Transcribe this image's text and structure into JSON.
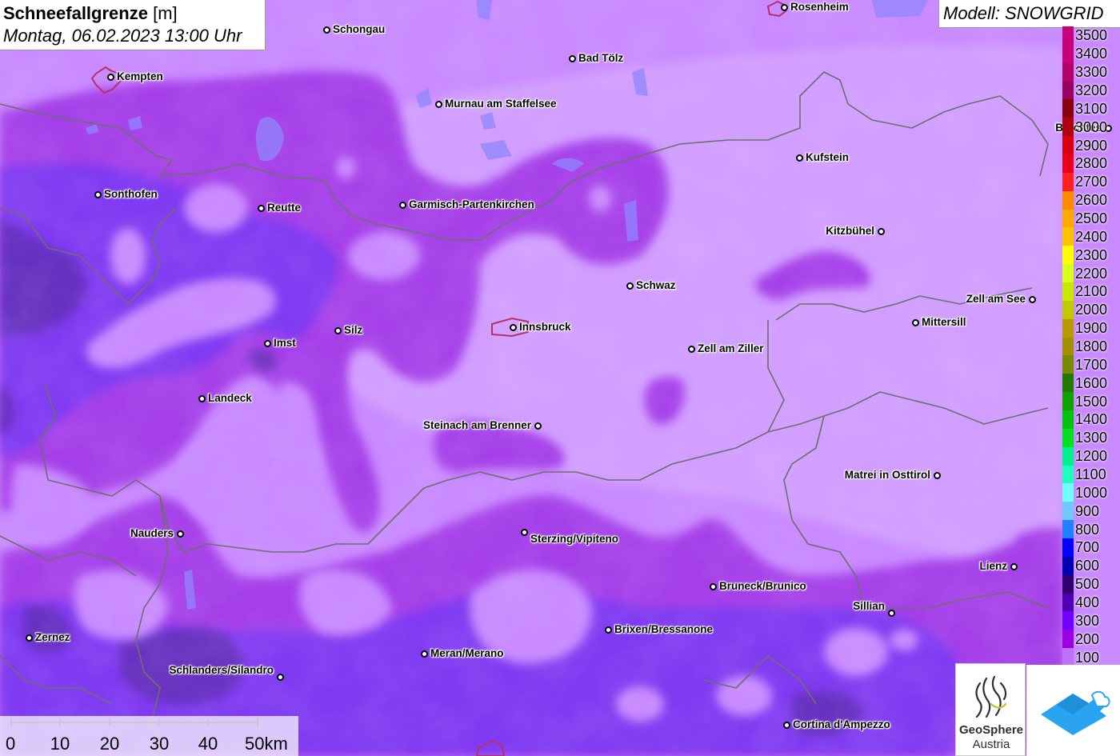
{
  "title": {
    "main": "Schneefallgrenze",
    "unit": "[m]",
    "date": "Montag, 06.02.2023 13:00 Uhr"
  },
  "model": "Modell: SNOWGRID",
  "colors": {
    "base": "#c97fff",
    "band_100": "#b86cf0",
    "band_200": "#9b28e0",
    "band_300": "#7a1cf0",
    "band_400": "#5a22b0",
    "border_line": "#6f6f6f",
    "lake": "#8e88ff"
  },
  "legend": [
    {
      "label": "3500",
      "color": "#c8007a"
    },
    {
      "label": "3400",
      "color": "#c8007a"
    },
    {
      "label": "3300",
      "color": "#b4006a"
    },
    {
      "label": "3200",
      "color": "#9a0060"
    },
    {
      "label": "3100",
      "color": "#8a0010"
    },
    {
      "label": "3000",
      "color": "#b00010"
    },
    {
      "label": "2900",
      "color": "#d80010"
    },
    {
      "label": "2800",
      "color": "#e80018"
    },
    {
      "label": "2700",
      "color": "#ff2020"
    },
    {
      "label": "2600",
      "color": "#ff8a00"
    },
    {
      "label": "2500",
      "color": "#ffa800"
    },
    {
      "label": "2400",
      "color": "#ffc000"
    },
    {
      "label": "2300",
      "color": "#ffff00"
    },
    {
      "label": "2200",
      "color": "#d8ff20"
    },
    {
      "label": "2100",
      "color": "#c8e800"
    },
    {
      "label": "2000",
      "color": "#c0c800"
    },
    {
      "label": "1900",
      "color": "#b89a00"
    },
    {
      "label": "1800",
      "color": "#a09000"
    },
    {
      "label": "1700",
      "color": "#7a8a00"
    },
    {
      "label": "1600",
      "color": "#207a00"
    },
    {
      "label": "1500",
      "color": "#10a000"
    },
    {
      "label": "1400",
      "color": "#00c010"
    },
    {
      "label": "1300",
      "color": "#00e020"
    },
    {
      "label": "1200",
      "color": "#00f090"
    },
    {
      "label": "1100",
      "color": "#20ffc0"
    },
    {
      "label": "1000",
      "color": "#70ffff"
    },
    {
      "label": "900",
      "color": "#70c8ff"
    },
    {
      "label": "800",
      "color": "#2080ff"
    },
    {
      "label": "700",
      "color": "#0000ff"
    },
    {
      "label": "600",
      "color": "#0000b0"
    },
    {
      "label": "500",
      "color": "#300070"
    },
    {
      "label": "400",
      "color": "#5000b0"
    },
    {
      "label": "300",
      "color": "#7000ff"
    },
    {
      "label": "200",
      "color": "#9a00e0"
    },
    {
      "label": "100",
      "color": "#c070ff"
    }
  ],
  "cities": [
    {
      "id": "rosenheim",
      "label": "Rosenheim"
    },
    {
      "id": "schongau",
      "label": "Schongau"
    },
    {
      "id": "bad-toelz",
      "label": "Bad Tölz"
    },
    {
      "id": "kempten",
      "label": "Kempten"
    },
    {
      "id": "murnau",
      "label": "Murnau am Staffelsee"
    },
    {
      "id": "berchtesgaden",
      "label": "Berchtes"
    },
    {
      "id": "kufstein",
      "label": "Kufstein"
    },
    {
      "id": "sonthofen",
      "label": "Sonthofen"
    },
    {
      "id": "reutte",
      "label": "Reutte"
    },
    {
      "id": "garmisch",
      "label": "Garmisch-Partenkirchen"
    },
    {
      "id": "kitzbuehel",
      "label": "Kitzbühel"
    },
    {
      "id": "schwaz",
      "label": "Schwaz"
    },
    {
      "id": "zell-am-see",
      "label": "Zell am See"
    },
    {
      "id": "mittersill",
      "label": "Mittersill"
    },
    {
      "id": "innsbruck",
      "label": "Innsbruck"
    },
    {
      "id": "imst",
      "label": "Imst"
    },
    {
      "id": "silz",
      "label": "Silz"
    },
    {
      "id": "zell-am-ziller",
      "label": "Zell am Ziller"
    },
    {
      "id": "landeck",
      "label": "Landeck"
    },
    {
      "id": "steinach",
      "label": "Steinach am Brenner"
    },
    {
      "id": "matrei",
      "label": "Matrei in Osttirol"
    },
    {
      "id": "nauders",
      "label": "Nauders"
    },
    {
      "id": "sterzing",
      "label": "Sterzing/Vipiteno"
    },
    {
      "id": "lienz",
      "label": "Lienz"
    },
    {
      "id": "bruneck",
      "label": "Bruneck/Brunico"
    },
    {
      "id": "sillian",
      "label": "Sillian"
    },
    {
      "id": "brixen",
      "label": "Brixen/Bressanone"
    },
    {
      "id": "zernez",
      "label": "Zernez"
    },
    {
      "id": "meran",
      "label": "Meran/Merano"
    },
    {
      "id": "schlanders",
      "label": "Schlanders/Silandro"
    },
    {
      "id": "cortina",
      "label": "Cortina d'Ampezzo"
    }
  ],
  "scale": {
    "ticks": [
      "0",
      "10",
      "20",
      "30",
      "40",
      "50km"
    ]
  },
  "logos": {
    "geosphere_line1": "GeoSphere",
    "geosphere_line2": "Austria"
  }
}
